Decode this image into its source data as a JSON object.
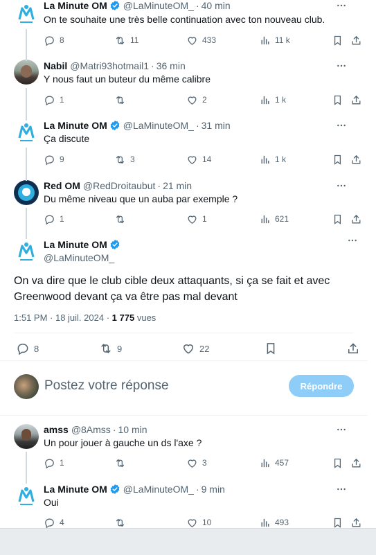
{
  "colors": {
    "accent": "#1d9bf0",
    "muted": "#536471",
    "line": "#cfd9de",
    "reply_button_bg": "#8ecdf8"
  },
  "tweets": [
    {
      "name": "La Minute OM",
      "handle": "@LaMinuteOM_",
      "time": "40 min",
      "text": "On te souhaite une très belle continuation avec ton nouveau club.",
      "replies": "8",
      "retweets": "11",
      "likes": "433",
      "views": "11 k",
      "verified": true,
      "avatar": "om-logo"
    },
    {
      "name": "Nabil",
      "handle": "@Matri93hotmail1",
      "time": "36 min",
      "text": "Y nous faut un buteur du même calibre",
      "replies": "1",
      "retweets": "",
      "likes": "2",
      "views": "1 k",
      "verified": false,
      "avatar": "photo"
    },
    {
      "name": "La Minute OM",
      "handle": "@LaMinuteOM_",
      "time": "31 min",
      "text": "Ça discute",
      "replies": "9",
      "retweets": "3",
      "likes": "14",
      "views": "1 k",
      "verified": true,
      "avatar": "om-logo"
    },
    {
      "name": "Red OM",
      "handle": "@RedDroitaubut",
      "time": "21 min",
      "text": "Du même niveau que un auba par exemple ?",
      "replies": "1",
      "retweets": "",
      "likes": "1",
      "views": "621",
      "verified": false,
      "avatar": "om-round"
    }
  ],
  "main_tweet": {
    "name": "La Minute OM",
    "handle": "@LaMinuteOM_",
    "text": "On va dire que le club cible deux attaquants, si ça se fait et avec Greenwood devant ça va être pas mal devant",
    "time": "1:51 PM · 18 juil. 2024",
    "views_count": "1 775",
    "views_label": "vues",
    "replies": "8",
    "retweets": "9",
    "likes": "22"
  },
  "reply_box": {
    "placeholder": "Postez votre réponse",
    "button": "Répondre"
  },
  "replies": [
    {
      "name": "amss",
      "handle": "@8Amss",
      "time": "10 min",
      "text": "Un pour jouer à gauche un ds l'axe ?",
      "replies": "1",
      "retweets": "",
      "likes": "3",
      "views": "457",
      "verified": false,
      "avatar": "photo2"
    },
    {
      "name": "La Minute OM",
      "handle": "@LaMinuteOM_",
      "time": "9 min",
      "text": "Oui",
      "replies": "4",
      "retweets": "",
      "likes": "10",
      "views": "493",
      "verified": true,
      "avatar": "om-logo"
    }
  ],
  "dot": "·"
}
